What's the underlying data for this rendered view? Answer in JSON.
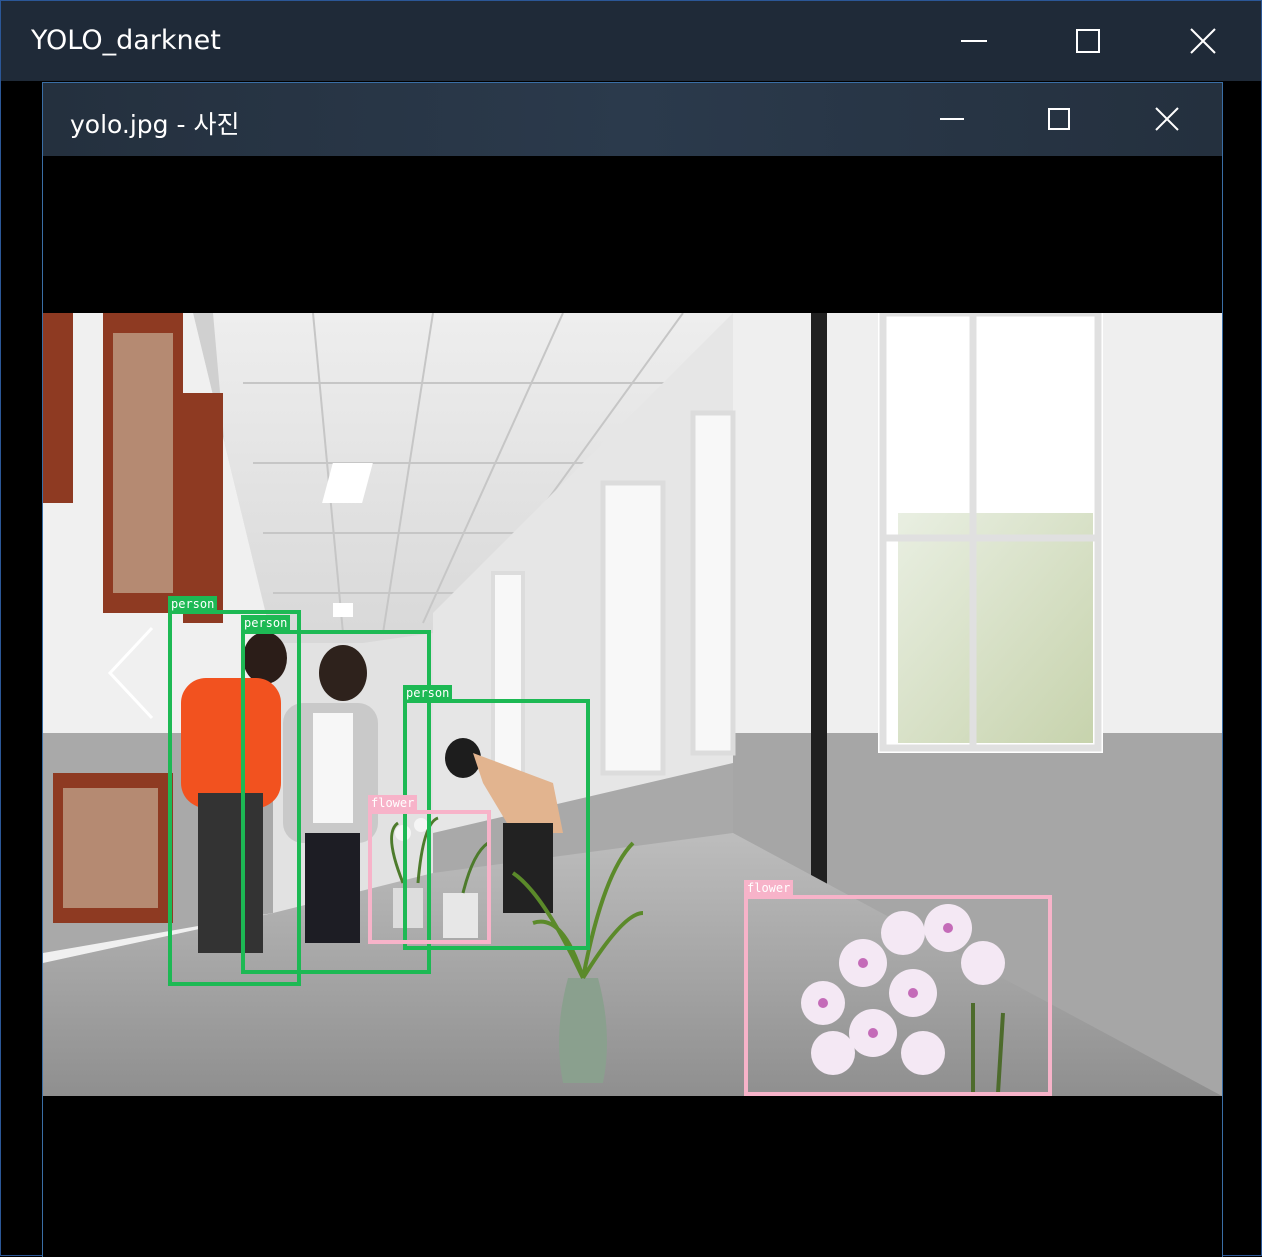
{
  "outer_window": {
    "title": "YOLO_darknet",
    "buttons": [
      "minimize-icon",
      "maximize-icon",
      "close-icon"
    ]
  },
  "photo_window": {
    "title": "yolo.jpg - 사진",
    "buttons": [
      "minimize-icon",
      "maximize-icon",
      "close-icon"
    ],
    "nav": {
      "previous": "chevron-left-icon"
    }
  },
  "detections": [
    {
      "label": "person",
      "color": "#1db954"
    },
    {
      "label": "person",
      "color": "#1db954"
    },
    {
      "label": "person",
      "color": "#1db954"
    },
    {
      "label": "flower",
      "color": "#f7b3c9"
    },
    {
      "label": "flower",
      "color": "#f7b3c9"
    }
  ]
}
